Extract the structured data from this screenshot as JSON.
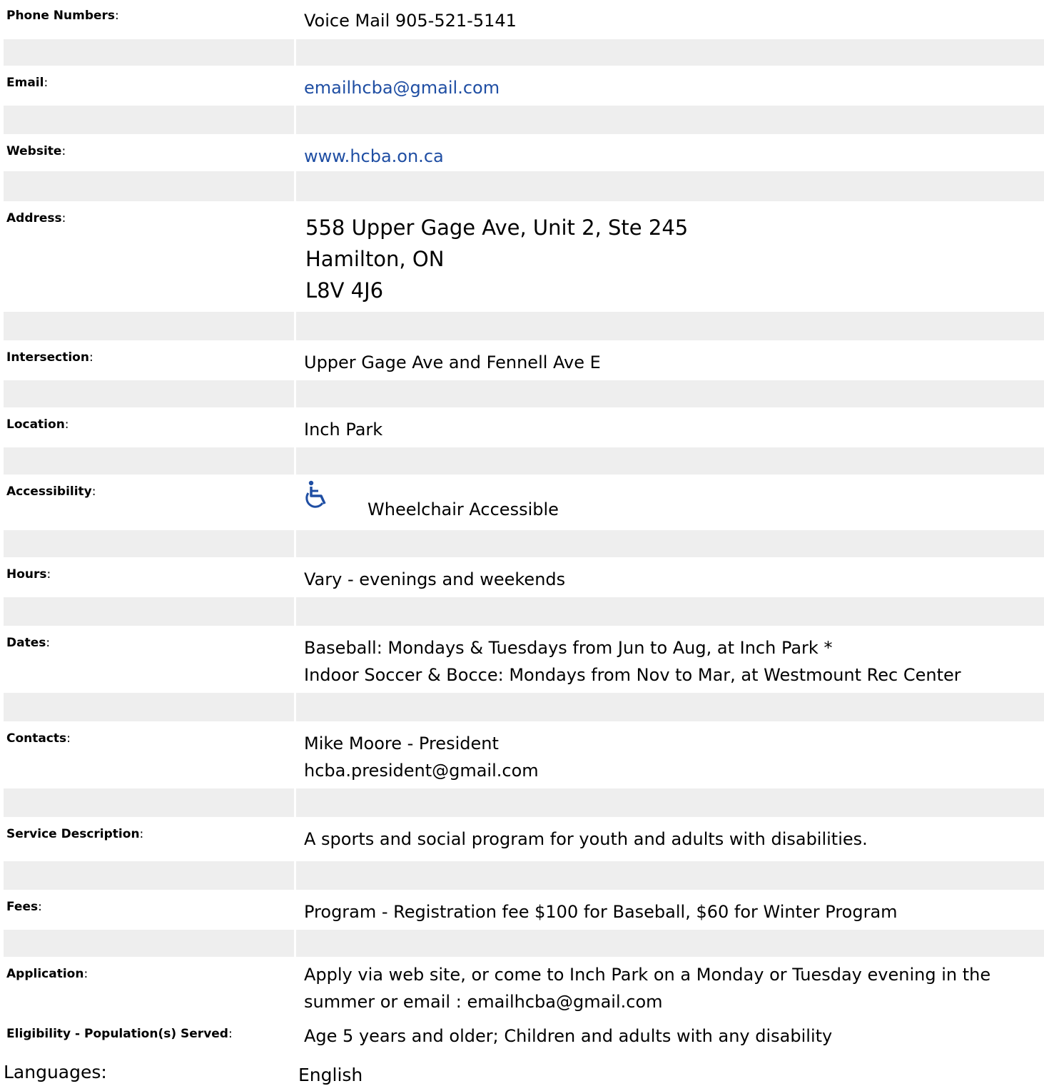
{
  "rows": [
    {
      "label": "Phone Numbers",
      "lines": [
        "Voice Mail 905-521-5141"
      ]
    },
    {
      "label": "Email",
      "lines": [
        "emailhcba@gmail.com"
      ]
    },
    {
      "label": "Website",
      "lines": [
        "www.hcba.on.ca"
      ]
    },
    {
      "label": "Address",
      "lines": [
        "558 Upper Gage Ave, Unit 2, Ste 245",
        "Hamilton, ON",
        "L8V 4J6"
      ]
    },
    {
      "label": "Intersection",
      "lines": [
        "Upper Gage Ave and Fennell Ave E"
      ]
    },
    {
      "label": "Location",
      "lines": [
        "Inch Park"
      ]
    },
    {
      "label": "Accessibility",
      "lines": [
        "Wheelchair Accessible"
      ],
      "icon": "wheelchair-icon"
    },
    {
      "label": "Hours",
      "lines": [
        "Vary - evenings and weekends"
      ]
    },
    {
      "label": "Dates",
      "lines": [
        "Baseball: Mondays & Tuesdays from Jun to Aug, at Inch Park *",
        "Indoor Soccer & Bocce: Mondays from Nov to Mar, at Westmount Rec Center"
      ]
    },
    {
      "label": "Contacts",
      "lines": [
        "Mike Moore - President",
        "hcba.president@gmail.com"
      ]
    },
    {
      "label": "Service Description",
      "lines": [
        "A sports and social program for youth and adults with disabilities."
      ]
    },
    {
      "label": "Fees",
      "lines": [
        "Program - Registration fee $100 for Baseball, $60 for Winter Program"
      ]
    },
    {
      "label": "Application",
      "lines": [
        "Apply via web site, or come to Inch Park on a Monday or Tuesday evening in the",
        "summer or email : emailhcba@gmail.com"
      ]
    },
    {
      "label": "Eligibility - Population(s) Served",
      "lines": [
        "Age 5 years and older; Children and adults with any disability"
      ]
    },
    {
      "label": "Languages",
      "lines": [
        "English"
      ]
    }
  ],
  "colon": ":",
  "colors": {
    "gap_row": "#eeeeee",
    "link": "#1f4ea3"
  }
}
